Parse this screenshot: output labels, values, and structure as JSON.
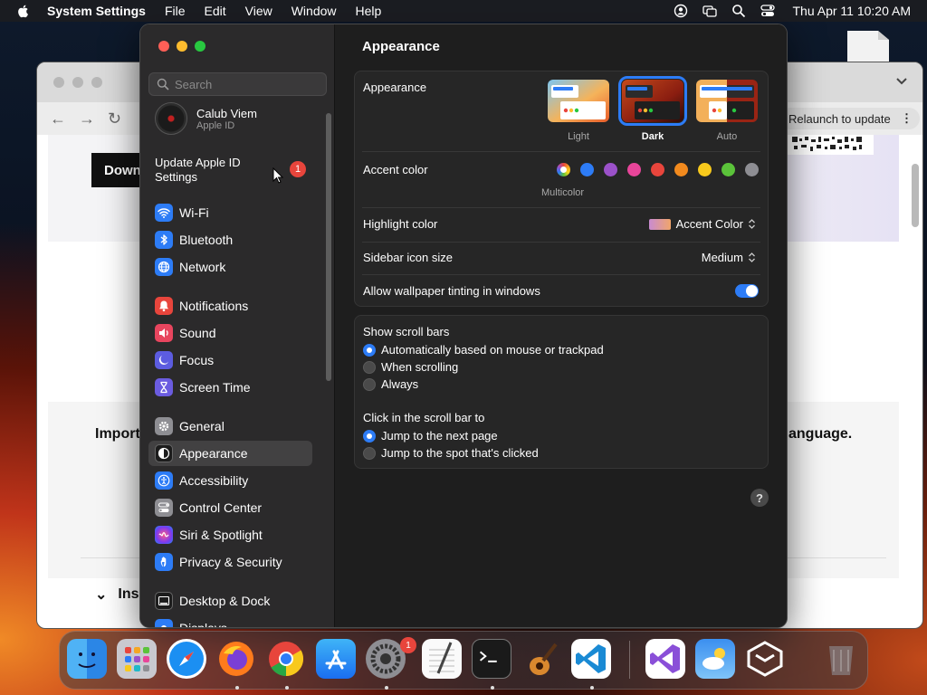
{
  "menubar": {
    "app": "System Settings",
    "items": [
      "File",
      "Edit",
      "View",
      "Window",
      "Help"
    ],
    "clock": "Thu Apr 11  10:20 AM",
    "icons": [
      "apple-logo-icon",
      "user-icon",
      "screen-mirroring-icon",
      "search-icon",
      "control-center-icon"
    ]
  },
  "browser": {
    "relaunch": "Relaunch to update",
    "download_label": "Down",
    "important_label": "Import",
    "language_label": "anguage.",
    "install_label": "Ins"
  },
  "sidebar": {
    "search_placeholder": "Search",
    "profile": {
      "name": "Calub Viem",
      "subtitle": "Apple ID"
    },
    "update": {
      "label": "Update Apple ID Settings",
      "badge": "1"
    },
    "items": [
      {
        "label": "Wi-Fi",
        "icon": "wifi-icon",
        "color": "#2d7cf6"
      },
      {
        "label": "Bluetooth",
        "icon": "bluetooth-icon",
        "color": "#2d7cf6"
      },
      {
        "label": "Network",
        "icon": "globe-icon",
        "color": "#2d7cf6"
      },
      {
        "label": "Notifications",
        "icon": "bell-icon",
        "color": "#e8453c"
      },
      {
        "label": "Sound",
        "icon": "speaker-icon",
        "color": "#e8455e"
      },
      {
        "label": "Focus",
        "icon": "moon-icon",
        "color": "#5c5ce0"
      },
      {
        "label": "Screen Time",
        "icon": "hourglass-icon",
        "color": "#6b5ce0"
      },
      {
        "label": "General",
        "icon": "gear-icon",
        "color": "#8e8e93"
      },
      {
        "label": "Appearance",
        "icon": "appearance-icon",
        "color": "#1c1c1c"
      },
      {
        "label": "Accessibility",
        "icon": "accessibility-icon",
        "color": "#2d7cf6"
      },
      {
        "label": "Control Center",
        "icon": "toggles-icon",
        "color": "#8e8e93"
      },
      {
        "label": "Siri & Spotlight",
        "icon": "siri-icon",
        "color": "#b24ad6"
      },
      {
        "label": "Privacy & Security",
        "icon": "hand-icon",
        "color": "#2d7cf6"
      },
      {
        "label": "Desktop & Dock",
        "icon": "dock-icon",
        "color": "#1c1c1c"
      },
      {
        "label": "Displays",
        "icon": "display-icon",
        "color": "#2d7cf6"
      }
    ],
    "selected": "Appearance"
  },
  "content": {
    "title": "Appearance",
    "appearance": {
      "label": "Appearance",
      "options": [
        "Light",
        "Dark",
        "Auto"
      ],
      "selected": "Dark"
    },
    "accent": {
      "label": "Accent color",
      "selected_label": "Multicolor",
      "colors": [
        "multicolor",
        "#2d7cf6",
        "#9b51c9",
        "#e8459a",
        "#e8453c",
        "#f28a1e",
        "#f8c91c",
        "#5bc33a",
        "#8e8e93"
      ]
    },
    "highlight": {
      "label": "Highlight color",
      "value": "Accent Color"
    },
    "sidebar_icon_size": {
      "label": "Sidebar icon size",
      "value": "Medium"
    },
    "wallpaper_tinting": {
      "label": "Allow wallpaper tinting in windows",
      "on": true
    },
    "scroll_bars": {
      "label": "Show scroll bars",
      "options": [
        "Automatically based on mouse or trackpad",
        "When scrolling",
        "Always"
      ],
      "selected": "Automatically based on mouse or trackpad"
    },
    "click_scroll": {
      "label": "Click in the scroll bar to",
      "options": [
        "Jump to the next page",
        "Jump to the spot that's clicked"
      ],
      "selected": "Jump to the next page"
    },
    "help": "?"
  },
  "dock": {
    "apps": [
      "Finder",
      "Launchpad",
      "Safari",
      "Firefox",
      "Google Chrome",
      "App Store",
      "System Settings",
      "TextEdit",
      "Terminal",
      "GarageBand",
      "Visual Studio Code",
      "Visual Studio",
      "Weather",
      "Parallels",
      "Trash"
    ],
    "settings_badge": "1"
  }
}
